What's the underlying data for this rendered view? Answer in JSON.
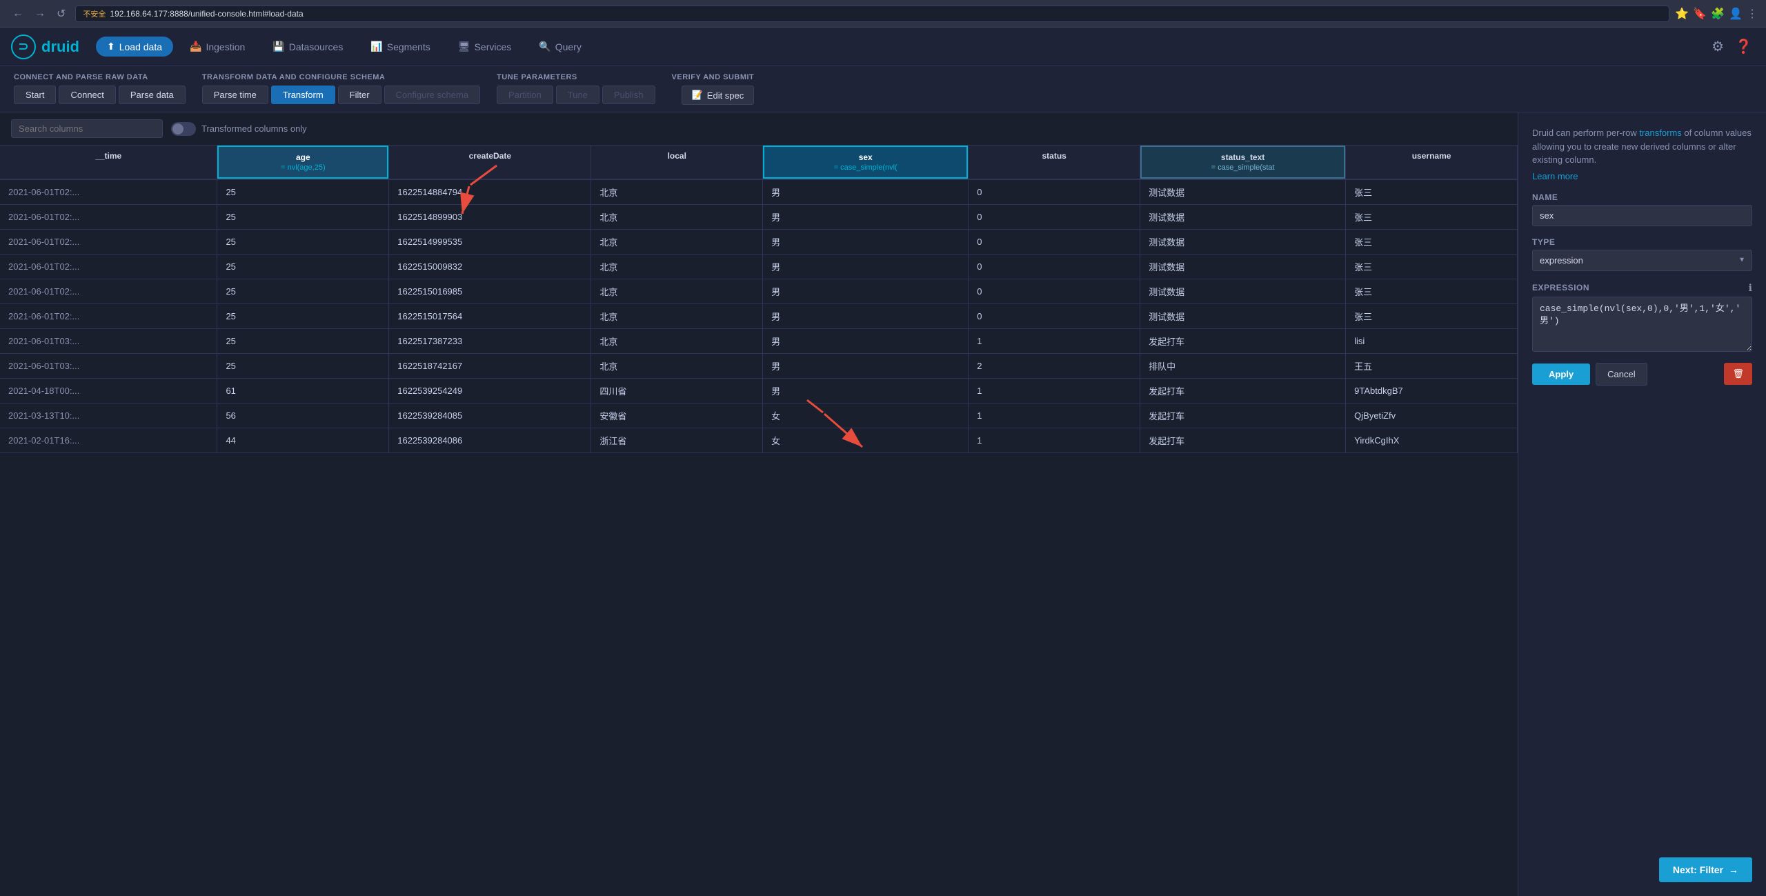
{
  "browser": {
    "back_label": "←",
    "forward_label": "→",
    "refresh_label": "↺",
    "warning_text": "不安全",
    "url": "192.168.64.177:8888/unified-console.html#load-data",
    "icons": [
      "⭐",
      "🔖",
      "🧩",
      "👤",
      "⋮"
    ]
  },
  "topnav": {
    "logo_text": "druid",
    "load_data_label": "Load data",
    "nav_items": [
      {
        "id": "ingestion",
        "label": "Ingestion",
        "icon": "📥"
      },
      {
        "id": "datasources",
        "label": "Datasources",
        "icon": "💾"
      },
      {
        "id": "segments",
        "label": "Segments",
        "icon": "📊"
      },
      {
        "id": "services",
        "label": "Services",
        "icon": "🖥"
      },
      {
        "id": "query",
        "label": "Query",
        "icon": "🔍"
      }
    ],
    "gear_icon": "⚙",
    "help_icon": "❓"
  },
  "steps": {
    "group1": {
      "label": "Connect and parse raw data",
      "buttons": [
        {
          "id": "start",
          "label": "Start",
          "state": "completed"
        },
        {
          "id": "connect",
          "label": "Connect",
          "state": "completed"
        },
        {
          "id": "parse-data",
          "label": "Parse data",
          "state": "completed"
        }
      ]
    },
    "group2": {
      "label": "Transform data and configure schema",
      "buttons": [
        {
          "id": "parse-time",
          "label": "Parse time",
          "state": "completed"
        },
        {
          "id": "transform",
          "label": "Transform",
          "state": "active"
        },
        {
          "id": "filter",
          "label": "Filter",
          "state": "completed"
        },
        {
          "id": "configure-schema",
          "label": "Configure schema",
          "state": "disabled"
        }
      ]
    },
    "group3": {
      "label": "Tune parameters",
      "buttons": [
        {
          "id": "partition",
          "label": "Partition",
          "state": "disabled"
        },
        {
          "id": "tune",
          "label": "Tune",
          "state": "disabled"
        },
        {
          "id": "publish",
          "label": "Publish",
          "state": "disabled"
        }
      ]
    },
    "group4": {
      "label": "Verify and submit",
      "edit_spec_label": "Edit spec",
      "edit_spec_icon": "📝"
    }
  },
  "toolbar": {
    "search_placeholder": "Search columns",
    "toggle_label": "Transformed columns only"
  },
  "table": {
    "columns": [
      {
        "id": "time",
        "label": "__time",
        "subtext": ""
      },
      {
        "id": "age",
        "label": "age",
        "subtext": "= nvl(age,25)",
        "transformed": true
      },
      {
        "id": "createDate",
        "label": "createDate",
        "subtext": ""
      },
      {
        "id": "local",
        "label": "local",
        "subtext": ""
      },
      {
        "id": "sex",
        "label": "sex",
        "subtext": "= case_simple(nvl(",
        "transformed": true,
        "selected": true
      },
      {
        "id": "status",
        "label": "status",
        "subtext": ""
      },
      {
        "id": "status_text",
        "label": "status_text",
        "subtext": "= case_simple(stat",
        "transformed": true
      },
      {
        "id": "username",
        "label": "username",
        "subtext": ""
      }
    ],
    "rows": [
      {
        "time": "2021-06-01T02:...",
        "age": "25",
        "createDate": "1622514884794",
        "local": "北京",
        "sex": "男",
        "status": "0",
        "status_text": "测试数据",
        "username": "张三"
      },
      {
        "time": "2021-06-01T02:...",
        "age": "25",
        "createDate": "1622514899903",
        "local": "北京",
        "sex": "男",
        "status": "0",
        "status_text": "测试数据",
        "username": "张三"
      },
      {
        "time": "2021-06-01T02:...",
        "age": "25",
        "createDate": "1622514999535",
        "local": "北京",
        "sex": "男",
        "status": "0",
        "status_text": "测试数据",
        "username": "张三"
      },
      {
        "time": "2021-06-01T02:...",
        "age": "25",
        "createDate": "1622515009832",
        "local": "北京",
        "sex": "男",
        "status": "0",
        "status_text": "测试数据",
        "username": "张三"
      },
      {
        "time": "2021-06-01T02:...",
        "age": "25",
        "createDate": "1622515016985",
        "local": "北京",
        "sex": "男",
        "status": "0",
        "status_text": "测试数据",
        "username": "张三"
      },
      {
        "time": "2021-06-01T02:...",
        "age": "25",
        "createDate": "1622515017564",
        "local": "北京",
        "sex": "男",
        "status": "0",
        "status_text": "测试数据",
        "username": "张三"
      },
      {
        "time": "2021-06-01T03:...",
        "age": "25",
        "createDate": "1622517387233",
        "local": "北京",
        "sex": "男",
        "status": "1",
        "status_text": "发起打车",
        "username": "lisi"
      },
      {
        "time": "2021-06-01T03:...",
        "age": "25",
        "createDate": "1622518742167",
        "local": "北京",
        "sex": "男",
        "status": "2",
        "status_text": "排队中",
        "username": "王五"
      },
      {
        "time": "2021-04-18T00:...",
        "age": "61",
        "createDate": "1622539254249",
        "local": "四川省",
        "sex": "男",
        "status": "1",
        "status_text": "发起打车",
        "username": "9TAbtdkgB7"
      },
      {
        "time": "2021-03-13T10:...",
        "age": "56",
        "createDate": "1622539284085",
        "local": "安徽省",
        "sex": "女",
        "status": "1",
        "status_text": "发起打车",
        "username": "QjByetiZfv"
      },
      {
        "time": "2021-02-01T16:...",
        "age": "44",
        "createDate": "1622539284086",
        "local": "浙江省",
        "sex": "女",
        "status": "1",
        "status_text": "发起打车",
        "username": "YirdkCgIhX"
      }
    ]
  },
  "right_panel": {
    "description": "Druid can perform per-row ",
    "transforms_link": "transforms",
    "description2": " of column values allowing you to create new derived columns or alter existing column.",
    "learn_more_label": "Learn more",
    "form": {
      "name_label": "Name",
      "name_value": "sex",
      "type_label": "Type",
      "type_value": "expression",
      "type_options": [
        "expression"
      ],
      "expression_label": "Expression",
      "expression_value": "case_simple(nvl(sex,0),0,'男',1,'女','男')",
      "info_icon": "ℹ"
    },
    "apply_label": "Apply",
    "cancel_label": "Cancel",
    "delete_icon": "🗑",
    "next_label": "Next: Filter",
    "next_icon": "→"
  }
}
